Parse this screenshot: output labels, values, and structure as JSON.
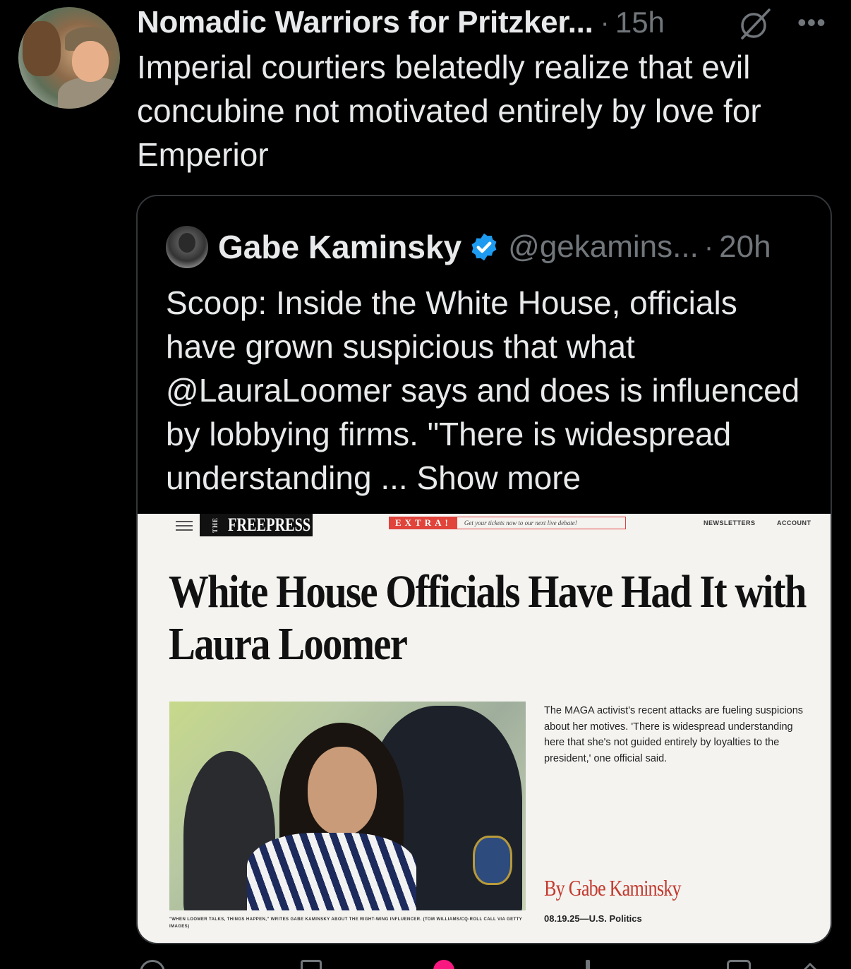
{
  "post": {
    "author_name": "Nomadic Warriors for Pritzker...",
    "separator": "·",
    "time": "15h",
    "text": "Imperial courtiers belatedly realize that evil concubine not motivated entirely by love for Emperior"
  },
  "quoted_post": {
    "author_name": "Gabe Kaminsky",
    "handle": "@gekamins...",
    "separator": "·",
    "time": "20h",
    "text": "Scoop: Inside the White House, officials have grown suspicious that what @LauraLoomer says and does is influenced by lobbying firms. \"There is widespread understanding ...",
    "show_more": "Show more"
  },
  "article": {
    "logo_the": "THE",
    "logo_main": "FREEPRESS",
    "extra_badge": "EXTRA!",
    "extra_text": "Get your tickets now to our next live debate!",
    "nav_newsletters": "NEWSLETTERS",
    "nav_account": "ACCOUNT",
    "headline": "White House Officials Have Had It with Laura Loomer",
    "dek": "The MAGA activist's recent attacks are fueling suspicions about her motives. 'There is widespread understanding here that she's not guided entirely by loyalties to the president,' one official said.",
    "byline": "By Gabe Kaminsky",
    "dateline": "08.19.25—U.S. Politics",
    "photo_caption": "\"WHEN LOOMER TALKS, THINGS HAPPEN,\" WRITES GABE KAMINSKY ABOUT THE RIGHT-WING INFLUENCER. (TOM WILLIAMS/CQ-ROLL CALL VIA GETTY IMAGES)"
  },
  "colors": {
    "background": "#000000",
    "text": "#e7e9ea",
    "secondary": "#71767b",
    "verified": "#1d9bf0",
    "like": "#f91880",
    "byline": "#c33a2e"
  },
  "icons": [
    "grok-icon",
    "more-icon",
    "verified-badge-icon",
    "menu-icon",
    "reply-icon",
    "repost-icon",
    "like-icon",
    "views-icon",
    "bookmark-icon",
    "share-icon"
  ]
}
